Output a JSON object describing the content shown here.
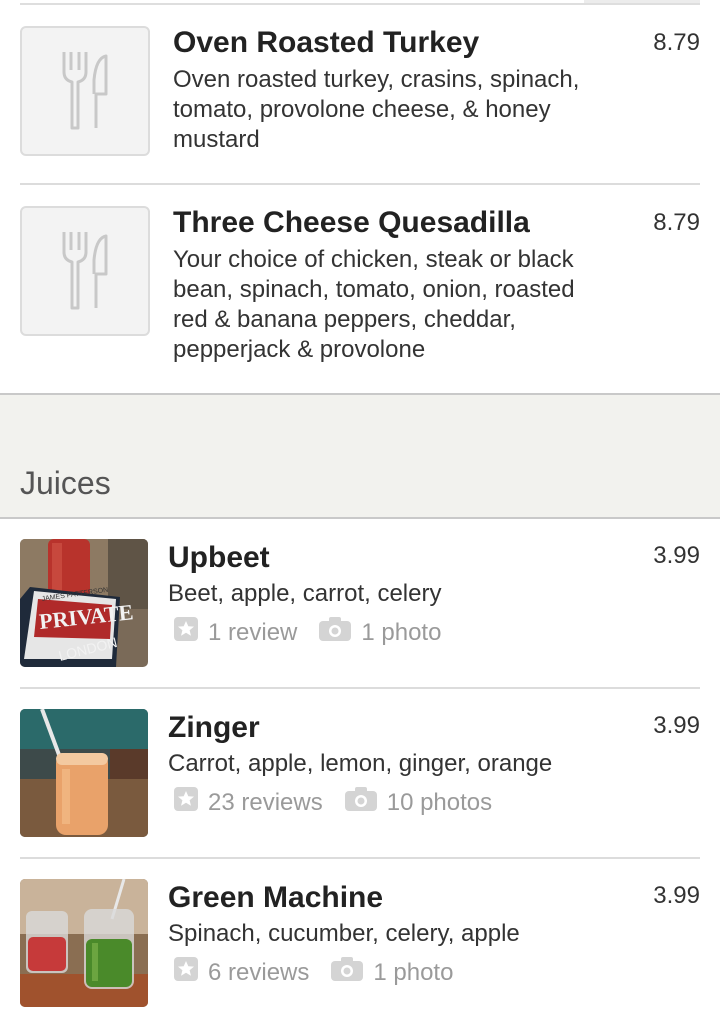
{
  "top_items": [
    {
      "name": "Oven Roasted Turkey",
      "price": "8.79",
      "description_lines": [
        "Oven roasted turkey, crasins, spinach,",
        "tomato, provolone cheese, & honey",
        "mustard"
      ]
    },
    {
      "name": "Three Cheese Quesadilla",
      "price": "8.79",
      "description_lines": [
        "Your choice of chicken, steak or black",
        "bean, spinach, tomato, onion, roasted",
        "red & banana peppers, cheddar,",
        "pepperjack & provolone"
      ]
    }
  ],
  "section": {
    "title": "Juices"
  },
  "juices": [
    {
      "name": "Upbeet",
      "price": "3.99",
      "description": "Beet, apple, carrot, celery",
      "reviews": "1 review",
      "photos": "1 photo"
    },
    {
      "name": "Zinger",
      "price": "3.99",
      "description": "Carrot, apple, lemon, ginger, orange",
      "reviews": "23 reviews",
      "photos": "10 photos"
    },
    {
      "name": "Green Machine",
      "price": "3.99",
      "description": "Spinach, cucumber, celery, apple",
      "reviews": "6 reviews",
      "photos": "1 photo"
    }
  ],
  "photo_text": {
    "book_line1": "JAMES PATTERSON",
    "book_line2": "PRIVATE",
    "book_line3": "LONDON"
  },
  "colors": {
    "meta_gray": "#9a9a9a",
    "band": "#f2f2ee",
    "placeholder": "#f3f3f3"
  },
  "icons": {
    "placeholder": "fork-knife-icon",
    "review": "star-icon",
    "photo": "camera-icon"
  }
}
